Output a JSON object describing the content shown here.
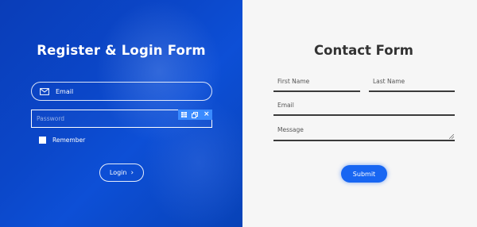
{
  "left_form": {
    "title": "Register & Login Form",
    "email_label": "Email",
    "password_placeholder": "Password",
    "remember_label": "Remember",
    "login_label": "Login",
    "login_chevron": "›",
    "toolbar": {
      "icons": [
        "grid-icon",
        "duplicate-icon",
        "close-icon"
      ],
      "close_glyph": "×"
    }
  },
  "right_form": {
    "title": "Contact Form",
    "first_name_label": "First Name",
    "last_name_label": "Last Name",
    "email_label": "Email",
    "message_label": "Message",
    "submit_label": "Submit"
  },
  "colors": {
    "left_background": "#0b47c9",
    "right_background": "#f6f6f6",
    "accent_blue": "#1866f2",
    "toolbar_blue": "#3a8bff",
    "title_dark": "#333333"
  }
}
